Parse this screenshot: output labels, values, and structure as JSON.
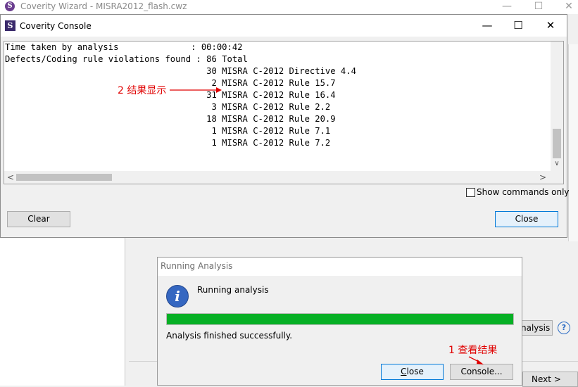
{
  "background_window": {
    "title": "Coverity Wizard - MISRA2012_flash.cwz",
    "controls": {
      "minimize": "—",
      "maximize": "☐",
      "close": "✕"
    },
    "analysis_button_label": "nalysis",
    "help_icon": "question-circle-icon",
    "next_button_label": "Next >"
  },
  "console": {
    "title": "Coverity Console",
    "controls": {
      "minimize": "—",
      "maximize": "☐",
      "close": "✕"
    },
    "output_lines": [
      "Time taken by analysis              : 00:00:42",
      "Defects/Coding rule violations found : 86 Total",
      "                                       30 MISRA C-2012 Directive 4.4",
      "                                        2 MISRA C-2012 Rule 15.7",
      "                                       31 MISRA C-2012 Rule 16.4",
      "                                        3 MISRA C-2012 Rule 2.2",
      "                                       18 MISRA C-2012 Rule 20.9",
      "                                        1 MISRA C-2012 Rule 7.1",
      "                                        1 MISRA C-2012 Rule 7.2"
    ],
    "show_commands_only_label": "Show commands only",
    "show_commands_only_checked": false,
    "clear_button": "Clear",
    "close_button": "Close",
    "scroll": {
      "left_arrow": "<",
      "right_arrow": ">",
      "down_arrow": "∨"
    }
  },
  "annotations": {
    "result_display": "2 结果显示",
    "view_result": "1 查看结果",
    "color": "#e00000"
  },
  "dialog": {
    "title": "Running Analysis",
    "message": "Running analysis",
    "progress_fraction": 1.0,
    "progress_color": "#06b025",
    "status": "Analysis finished successfully.",
    "close_button": "Close",
    "console_button": "Console..."
  }
}
